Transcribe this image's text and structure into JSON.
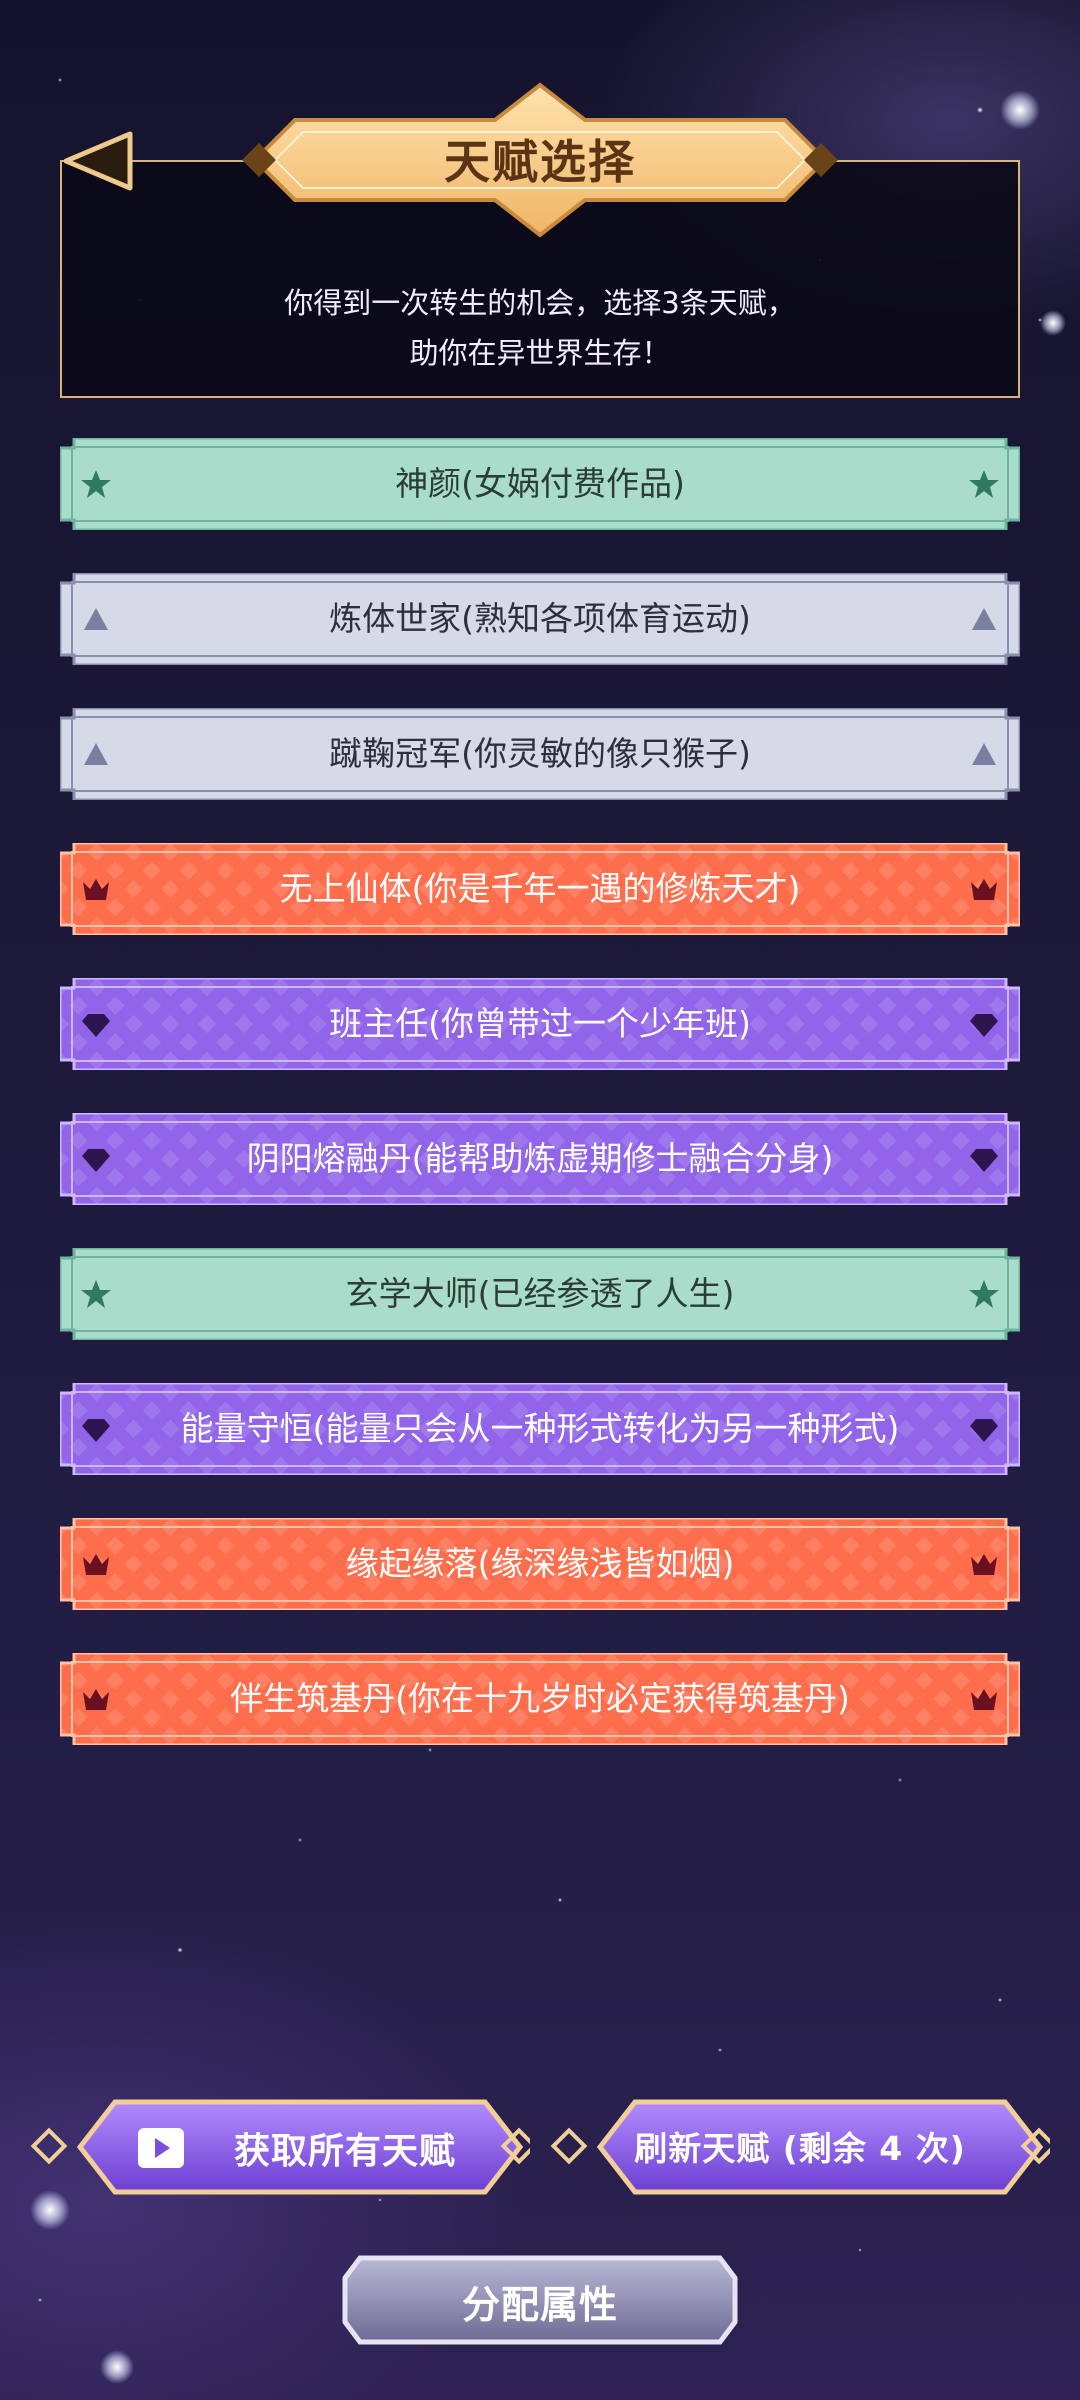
{
  "header": {
    "title": "天赋选择",
    "subtitle_line1": "你得到一次转生的机会，选择3条天赋，",
    "subtitle_line2": "助你在异世界生存！"
  },
  "talents": [
    {
      "label": "神颜(女娲付费作品)",
      "rarity": "green",
      "icon": "star-icon"
    },
    {
      "label": "炼体世家(熟知各项体育运动)",
      "rarity": "gray",
      "icon": "triangle-icon"
    },
    {
      "label": "蹴鞠冠军(你灵敏的像只猴子)",
      "rarity": "gray",
      "icon": "triangle-icon"
    },
    {
      "label": "无上仙体(你是千年一遇的修炼天才)",
      "rarity": "red",
      "icon": "crown-icon"
    },
    {
      "label": "班主任(你曾带过一个少年班)",
      "rarity": "purple",
      "icon": "diamond-icon"
    },
    {
      "label": "阴阳熔融丹(能帮助炼虚期修士融合分身)",
      "rarity": "purple",
      "icon": "diamond-icon"
    },
    {
      "label": "玄学大师(已经参透了人生)",
      "rarity": "green",
      "icon": "star-icon"
    },
    {
      "label": "能量守恒(能量只会从一种形式转化为另一种形式)",
      "rarity": "purple",
      "icon": "diamond-icon"
    },
    {
      "label": "缘起缘落(缘深缘浅皆如烟)",
      "rarity": "red",
      "icon": "crown-icon"
    },
    {
      "label": "伴生筑基丹(你在十九岁时必定获得筑基丹)",
      "rarity": "red",
      "icon": "crown-icon"
    }
  ],
  "buttons": {
    "get_all": "获取所有天赋",
    "refresh": "刷新天赋 (剩余 4 次)",
    "allocate": "分配属性"
  },
  "colors": {
    "green": "#9ed3bf",
    "gray": "#cdd1e2",
    "red": "#ff6b4a",
    "purple": "#8f62e6",
    "gold": "#d9b27a"
  }
}
